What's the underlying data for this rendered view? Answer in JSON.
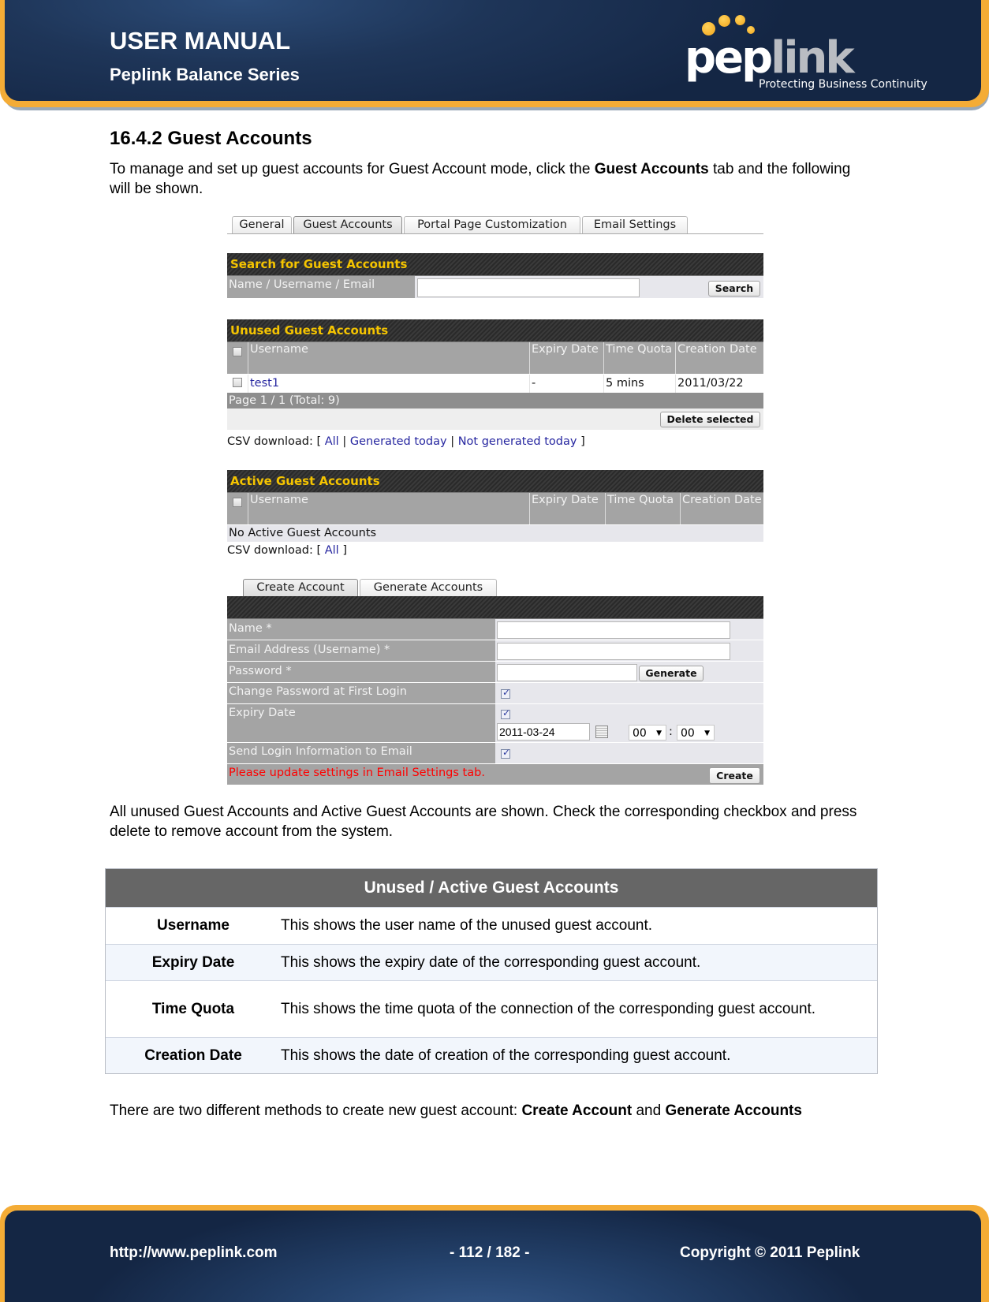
{
  "header": {
    "title": "USER MANUAL",
    "subtitle": "Peplink Balance Series",
    "logo_part1": "pep",
    "logo_part2": "link",
    "logo_tagline": "Protecting Business Continuity"
  },
  "section": {
    "title": "16.4.2 Guest Accounts",
    "intro_before": "To manage and set up guest accounts for Guest Account mode, click the ",
    "intro_bold": "Guest Accounts",
    "intro_after": " tab and the following will be shown.",
    "after_screenshot": "All unused Guest Accounts and Active Guest Accounts are shown. Check the corresponding checkbox and press delete to remove account from the system.",
    "closing_before": "There are two different methods to create new guest account: ",
    "closing_bold1": "Create Account",
    "closing_mid": " and ",
    "closing_bold2": "Generate Accounts"
  },
  "ui": {
    "tabs": [
      {
        "label": "General",
        "active": false
      },
      {
        "label": "Guest Accounts",
        "active": true
      },
      {
        "label": "Portal Page Customization",
        "active": false
      },
      {
        "label": "Email Settings",
        "active": false
      }
    ],
    "search": {
      "title": "Search for Guest Accounts",
      "label": "Name / Username / Email",
      "value": "",
      "button": "Search"
    },
    "unused": {
      "title": "Unused Guest Accounts",
      "columns": [
        "Username",
        "Expiry Date",
        "Time Quota",
        "Creation Date"
      ],
      "rows": [
        {
          "username": "test1",
          "expiry": "-",
          "quota": "5 mins",
          "created": "2011/03/22",
          "checked": false
        }
      ],
      "pagination": "Page 1 / 1 (Total: 9)",
      "delete_button": "Delete selected",
      "csv_label": "CSV download: [",
      "csv_links": [
        "All",
        "Generated today",
        "Not generated today"
      ],
      "csv_sep": "|",
      "csv_end": "]"
    },
    "active": {
      "title": "Active Guest Accounts",
      "columns": [
        "Username",
        "Expiry Date",
        "Time Quota",
        "Creation Date"
      ],
      "empty": "No Active Guest Accounts",
      "csv_label": "CSV download: [",
      "csv_links": [
        "All"
      ],
      "csv_end": "]"
    },
    "create": {
      "tabs": [
        {
          "label": "Create Account",
          "active": true
        },
        {
          "label": "Generate Accounts",
          "active": false
        }
      ],
      "fields": {
        "name_label": "Name *",
        "name_value": "",
        "email_label": "Email Address (Username) *",
        "email_value": "",
        "password_label": "Password *",
        "password_value": "",
        "generate_button": "Generate",
        "change_pw_label": "Change Password at First Login",
        "change_pw_checked": true,
        "expiry_label": "Expiry Date",
        "expiry_checked": true,
        "expiry_date": "2011-03-24",
        "expiry_hour": "00",
        "expiry_minute": "00",
        "time_sep": ":",
        "send_login_label": "Send Login Information to Email",
        "send_login_checked": true
      },
      "warning": "Please update settings in Email Settings tab.",
      "create_button": "Create",
      "colors": {
        "warning": "#ff0000",
        "section_title": "#f5c400"
      }
    }
  },
  "reference_table": {
    "title": "Unused / Active Guest Accounts",
    "rows": [
      {
        "term": "Username",
        "desc": "This shows the user name of the unused guest account."
      },
      {
        "term": "Expiry Date",
        "desc": "This shows the expiry date of the corresponding guest account."
      },
      {
        "term": "Time Quota",
        "desc": "This shows the time quota of the connection of the corresponding guest account."
      },
      {
        "term": "Creation Date",
        "desc": "This shows the date of creation of the corresponding guest account."
      }
    ]
  },
  "footer": {
    "url": "http://www.peplink.com",
    "page": "- 112 / 182 -",
    "copyright": "Copyright © 2011 Peplink"
  }
}
